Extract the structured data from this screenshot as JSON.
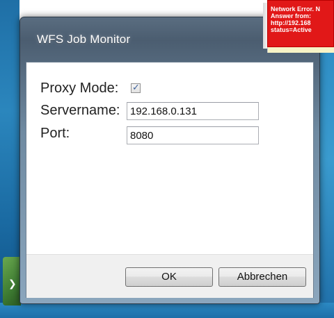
{
  "window": {
    "title": "WFS Job Monitor"
  },
  "form": {
    "proxy_mode_label": "Proxy Mode:",
    "proxy_mode_checked": true,
    "servername_label": "Servername:",
    "servername_value": "192.168.0.131",
    "port_label": "Port:",
    "port_value": "8080"
  },
  "buttons": {
    "ok_label": "OK",
    "cancel_label": "Abbrechen"
  },
  "notification": {
    "text": "Network Error. N\nAnswer from:\nhttp://192.168\nstatus=Active",
    "background_color": "#e11818"
  },
  "icons": {
    "checkbox": "checkmark-icon"
  }
}
